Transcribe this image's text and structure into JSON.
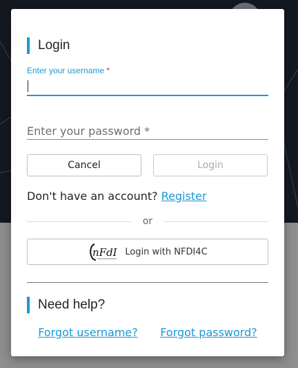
{
  "login_modal": {
    "title": "Login",
    "username": {
      "label": "Enter your username",
      "required_mark": "*",
      "value": ""
    },
    "password": {
      "placeholder": "Enter your password *",
      "value": ""
    },
    "cancel_label": "Cancel",
    "login_label": "Login",
    "no_account_text": "Don't have an account?",
    "register_label": "Register",
    "or_text": "or",
    "nfdi_login_label": "Login with NFDI4C",
    "nfdi_logo_text": "nFdI",
    "help": {
      "title": "Need help?",
      "forgot_username": "Forgot username?",
      "forgot_password": "Forgot password?"
    }
  },
  "colors": {
    "accent": "#1a98d5",
    "required": "#d32f2f",
    "overlay": "#8e8e8e"
  }
}
